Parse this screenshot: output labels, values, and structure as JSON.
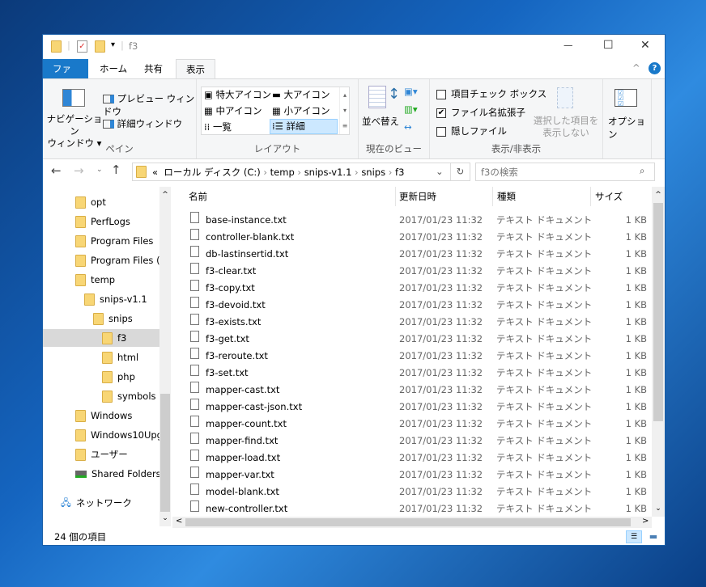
{
  "window": {
    "title": "f3",
    "controls": {
      "minimize": "—",
      "maximize": "☐",
      "close": "✕"
    }
  },
  "tabs": [
    "ファイル",
    "ホーム",
    "共有",
    "表示"
  ],
  "ribbon": {
    "pane": {
      "nav_pane": "ナビゲーション\nウィンドウ ▾",
      "preview": "プレビュー ウィンドウ",
      "details": "詳細ウィンドウ",
      "label": "ペイン"
    },
    "layout": {
      "items": [
        "特大アイコン",
        "大アイコン",
        "中アイコン",
        "小アイコン",
        "一覧",
        "詳細"
      ],
      "selected": "詳細",
      "label": "レイアウト"
    },
    "current_view": {
      "sort": "並べ替え",
      "label": "現在のビュー"
    },
    "show_hide": {
      "item_checkboxes": "項目チェック ボックス",
      "item_checkboxes_checked": false,
      "extensions": "ファイル名拡張子",
      "extensions_checked": true,
      "hidden": "隠しファイル",
      "hidden_checked": false,
      "hide_selected": "選択した項目を\n表示しない",
      "label": "表示/非表示"
    },
    "options": "オプション"
  },
  "address": {
    "path": [
      "«",
      "ローカル ディスク (C:)",
      "temp",
      "snips-v1.1",
      "snips",
      "f3"
    ],
    "search_placeholder": "f3の検索"
  },
  "nav": [
    {
      "label": "opt",
      "indent": 0
    },
    {
      "label": "PerfLogs",
      "indent": 0
    },
    {
      "label": "Program Files",
      "indent": 0
    },
    {
      "label": "Program Files (x",
      "indent": 0
    },
    {
      "label": "temp",
      "indent": 0
    },
    {
      "label": "snips-v1.1",
      "indent": 1
    },
    {
      "label": "snips",
      "indent": 2
    },
    {
      "label": "f3",
      "indent": 3,
      "selected": true
    },
    {
      "label": "html",
      "indent": 3
    },
    {
      "label": "php",
      "indent": 3
    },
    {
      "label": "symbols",
      "indent": 3
    },
    {
      "label": "Windows",
      "indent": 0
    },
    {
      "label": "Windows10Upg",
      "indent": 0
    },
    {
      "label": "ユーザー",
      "indent": 0
    },
    {
      "label": "Shared Folders (¥",
      "indent": 0,
      "drive": true
    },
    {
      "label": "ネットワーク",
      "indent": -1,
      "network": true
    }
  ],
  "columns": [
    "名前",
    "更新日時",
    "種類",
    "サイズ"
  ],
  "files": [
    {
      "name": "base-instance.txt",
      "date": "2017/01/23 11:32",
      "type": "テキスト ドキュメント",
      "size": "1 KB"
    },
    {
      "name": "controller-blank.txt",
      "date": "2017/01/23 11:32",
      "type": "テキスト ドキュメント",
      "size": "1 KB"
    },
    {
      "name": "db-lastinsertid.txt",
      "date": "2017/01/23 11:32",
      "type": "テキスト ドキュメント",
      "size": "1 KB"
    },
    {
      "name": "f3-clear.txt",
      "date": "2017/01/23 11:32",
      "type": "テキスト ドキュメント",
      "size": "1 KB"
    },
    {
      "name": "f3-copy.txt",
      "date": "2017/01/23 11:32",
      "type": "テキスト ドキュメント",
      "size": "1 KB"
    },
    {
      "name": "f3-devoid.txt",
      "date": "2017/01/23 11:32",
      "type": "テキスト ドキュメント",
      "size": "1 KB"
    },
    {
      "name": "f3-exists.txt",
      "date": "2017/01/23 11:32",
      "type": "テキスト ドキュメント",
      "size": "1 KB"
    },
    {
      "name": "f3-get.txt",
      "date": "2017/01/23 11:32",
      "type": "テキスト ドキュメント",
      "size": "1 KB"
    },
    {
      "name": "f3-reroute.txt",
      "date": "2017/01/23 11:32",
      "type": "テキスト ドキュメント",
      "size": "1 KB"
    },
    {
      "name": "f3-set.txt",
      "date": "2017/01/23 11:32",
      "type": "テキスト ドキュメント",
      "size": "1 KB"
    },
    {
      "name": "mapper-cast.txt",
      "date": "2017/01/23 11:32",
      "type": "テキスト ドキュメント",
      "size": "1 KB"
    },
    {
      "name": "mapper-cast-json.txt",
      "date": "2017/01/23 11:32",
      "type": "テキスト ドキュメント",
      "size": "1 KB"
    },
    {
      "name": "mapper-count.txt",
      "date": "2017/01/23 11:32",
      "type": "テキスト ドキュメント",
      "size": "1 KB"
    },
    {
      "name": "mapper-find.txt",
      "date": "2017/01/23 11:32",
      "type": "テキスト ドキュメント",
      "size": "1 KB"
    },
    {
      "name": "mapper-load.txt",
      "date": "2017/01/23 11:32",
      "type": "テキスト ドキュメント",
      "size": "1 KB"
    },
    {
      "name": "mapper-var.txt",
      "date": "2017/01/23 11:32",
      "type": "テキスト ドキュメント",
      "size": "1 KB"
    },
    {
      "name": "model-blank.txt",
      "date": "2017/01/23 11:32",
      "type": "テキスト ドキュメント",
      "size": "1 KB"
    },
    {
      "name": "new-controller.txt",
      "date": "2017/01/23 11:32",
      "type": "テキスト ドキュメント",
      "size": "1 KB"
    }
  ],
  "status": "24 個の項目",
  "colors": {
    "file_tab": "#1979ca",
    "selected": "#cce8ff",
    "nav_selected": "#d9d9d9"
  }
}
